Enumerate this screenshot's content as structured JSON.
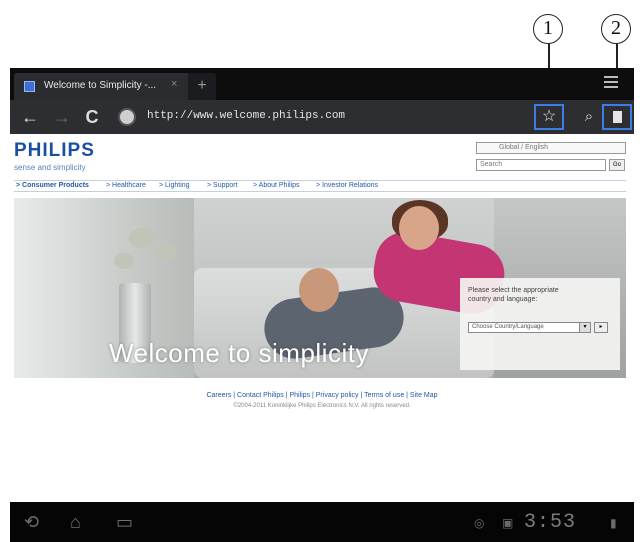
{
  "callouts": [
    "1",
    "2"
  ],
  "browser": {
    "tab_title": "Welcome to Simplicity -...",
    "tab_close": "×",
    "new_tab": "+",
    "url": "http://www.welcome.philips.com",
    "back": "←",
    "forward": "→",
    "reload": "C",
    "star": "☆",
    "search": "🔍",
    "accent_color": "#3c7ee6"
  },
  "page": {
    "logo": "PHILIPS",
    "tagline": "sense and simplicity",
    "language_select": "Global / English",
    "search_placeholder": "Search",
    "search_go": "Go",
    "nav": [
      "> Consumer Products",
      "> Healthcare",
      "> Lighting",
      "> Support",
      "> About Philips",
      "> Investor Relations"
    ],
    "hero_text": "Welcome to simplicity",
    "country_prompt": "Please select the appropriate country and language:",
    "country_select": "Choose Country/Language",
    "country_arrow": "▾",
    "country_go": "▸",
    "footer_links": "Careers | Contact Philips | Philips | Privacy policy | Terms of use | Site Map",
    "footer_copy": "©2004-2011 Koninklijke Philips Electronics N.V. All rights reserved."
  },
  "system_bar": {
    "back": "⟲",
    "home": "⌂",
    "recent": "▭",
    "clock": "3:53",
    "wifi": "▮"
  }
}
